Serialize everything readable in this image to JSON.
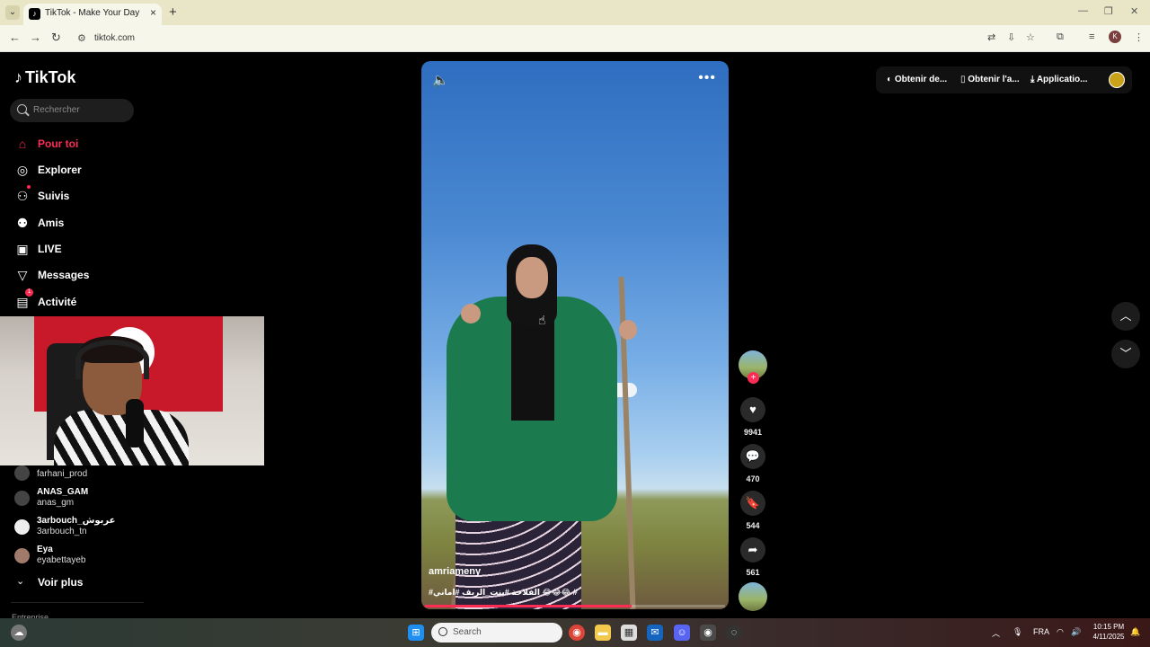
{
  "browser": {
    "tab_title": "TikTok - Make Your Day",
    "url": "tiktok.com",
    "profile_initial": "K"
  },
  "sidebar": {
    "logo": "TikTok",
    "search_placeholder": "Rechercher",
    "nav": [
      {
        "label": "Pour toi",
        "icon": "home-icon",
        "active": true
      },
      {
        "label": "Explorer",
        "icon": "compass-icon"
      },
      {
        "label": "Suivis",
        "icon": "following-icon"
      },
      {
        "label": "Amis",
        "icon": "friends-icon"
      },
      {
        "label": "LIVE",
        "icon": "live-icon"
      },
      {
        "label": "Messages",
        "icon": "messages-icon"
      },
      {
        "label": "Activité",
        "icon": "activity-icon",
        "badge": "1"
      }
    ],
    "following": [
      {
        "name": "",
        "handle": "farhani_prod"
      },
      {
        "name": "ANAS_GAM",
        "handle": "anas_gm"
      },
      {
        "name": "3arbouch_عربوش",
        "handle": "3arbouch_tn"
      },
      {
        "name": "Eya",
        "handle": "eyabettayeb"
      }
    ],
    "see_more": "Voir plus",
    "next_section": "Entreprise"
  },
  "video": {
    "author": "amriameny",
    "caption": "#الفلاحة #بنت_الريف #اماني 😂😂😂 #",
    "progress": 0.69
  },
  "actions": {
    "likes": "9941",
    "comments": "470",
    "saves": "544",
    "shares": "561"
  },
  "topbar": {
    "coins": "Obtenir de...",
    "app": "Obtenir l'a...",
    "install": "Applicatio..."
  },
  "taskbar": {
    "search": "Search",
    "lang": "FRA",
    "time": "10:15 PM",
    "date": "4/11/2025"
  },
  "colors": {
    "accent": "#fe2c55",
    "background": "#000000"
  }
}
